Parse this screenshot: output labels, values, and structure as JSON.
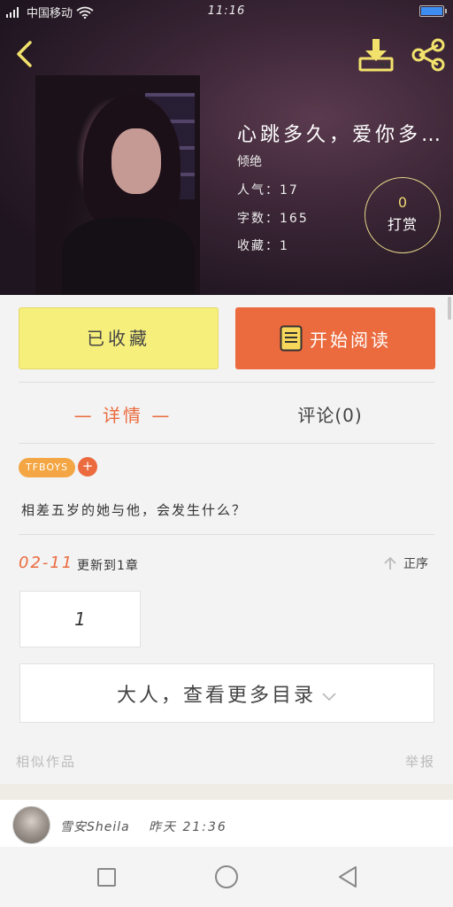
{
  "status_bar": {
    "network": "4G",
    "carrier": "中国移动",
    "time": "11:16"
  },
  "book": {
    "title": "心跳多久，爱你多…",
    "author": "倾绝",
    "popularity": "人气：17",
    "word_count": "字数：165",
    "favorites": "收藏：1"
  },
  "tip": {
    "count": "0",
    "label": "打赏"
  },
  "actions": {
    "favorited_label": "已收藏",
    "read_label": "开始阅读"
  },
  "tabs": {
    "detail": "— 详情 —",
    "comments": "评论(0)"
  },
  "tag": {
    "label": "TFBOYS",
    "add": "+"
  },
  "description": "相差五岁的她与他，会发生什么？",
  "update": {
    "date": "02-11",
    "text": "更新到1章",
    "sort_label": "正序"
  },
  "chapters": [
    "1"
  ],
  "more_catalog": "大人，查看更多目录",
  "similar_label": "相似作品",
  "report_label": "举报",
  "comment": {
    "user": "雪安Sheila",
    "time": "昨天 21:36"
  },
  "colors": {
    "accent": "#eb6a3e",
    "favorited_bg": "#f7ef7c",
    "tag_bg": "#f3a643",
    "icon_yellow": "#f2e26c"
  }
}
